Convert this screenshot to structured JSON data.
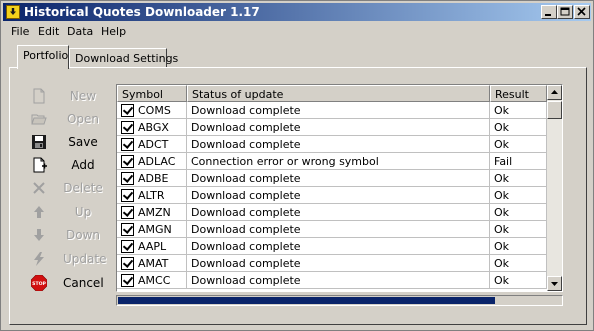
{
  "window": {
    "title": "Historical Quotes Downloader 1.17"
  },
  "menu": [
    "File",
    "Edit",
    "Data",
    "Help"
  ],
  "tabs": [
    {
      "label": "Portfolio",
      "active": true
    },
    {
      "label": "Download Settings",
      "active": false
    }
  ],
  "actions": [
    {
      "label": "New",
      "icon": "new-document-icon",
      "enabled": false
    },
    {
      "label": "Open",
      "icon": "open-folder-icon",
      "enabled": false
    },
    {
      "label": "Save",
      "icon": "floppy-disk-icon",
      "enabled": true
    },
    {
      "label": "Add",
      "icon": "add-icon",
      "enabled": true
    },
    {
      "label": "Delete",
      "icon": "delete-x-icon",
      "enabled": false
    },
    {
      "label": "Up",
      "icon": "arrow-up-icon",
      "enabled": false
    },
    {
      "label": "Down",
      "icon": "arrow-down-icon",
      "enabled": false
    },
    {
      "label": "Update",
      "icon": "lightning-icon",
      "enabled": false
    },
    {
      "label": "Cancel",
      "icon": "stop-sign-icon",
      "enabled": true,
      "icon_text": "STOP"
    }
  ],
  "table": {
    "columns": [
      "Symbol",
      "Status of update",
      "Result"
    ],
    "rows": [
      {
        "checked": true,
        "symbol": "COMS",
        "status": "Download complete",
        "result": "Ok"
      },
      {
        "checked": true,
        "symbol": "ABGX",
        "status": "Download complete",
        "result": "Ok"
      },
      {
        "checked": true,
        "symbol": "ADCT",
        "status": "Download complete",
        "result": "Ok"
      },
      {
        "checked": true,
        "symbol": "ADLAC",
        "status": "Connection error or wrong symbol",
        "result": "Fail"
      },
      {
        "checked": true,
        "symbol": "ADBE",
        "status": "Download complete",
        "result": "Ok"
      },
      {
        "checked": true,
        "symbol": "ALTR",
        "status": "Download complete",
        "result": "Ok"
      },
      {
        "checked": true,
        "symbol": "AMZN",
        "status": "Download complete",
        "result": "Ok"
      },
      {
        "checked": true,
        "symbol": "AMGN",
        "status": "Download complete",
        "result": "Ok"
      },
      {
        "checked": true,
        "symbol": "AAPL",
        "status": "Download complete",
        "result": "Ok"
      },
      {
        "checked": true,
        "symbol": "AMAT",
        "status": "Download complete",
        "result": "Ok"
      },
      {
        "checked": true,
        "symbol": "AMCC",
        "status": "Download complete",
        "result": "Ok"
      }
    ]
  },
  "progress": {
    "fraction": 0.85
  },
  "colors": {
    "title_start": "#0a246a",
    "title_end": "#a6caf0",
    "progress": "#0a246a",
    "face": "#d4d0c8"
  }
}
